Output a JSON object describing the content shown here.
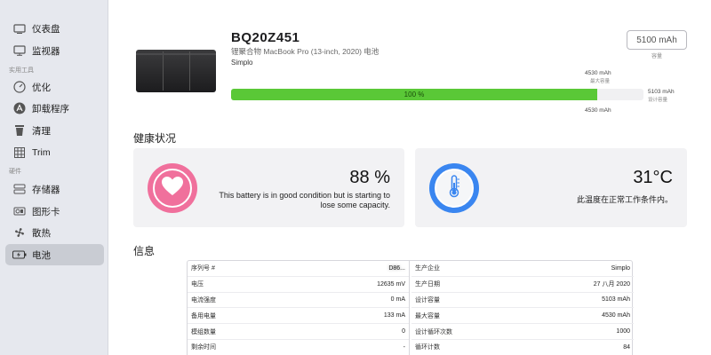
{
  "sidebar": {
    "items": [
      {
        "label": "仪表盘",
        "icon": "monitor-icon"
      },
      {
        "label": "监视器",
        "icon": "display-icon"
      },
      {
        "label": "优化",
        "icon": "gauge-icon"
      },
      {
        "label": "卸载程序",
        "icon": "app-store-icon"
      },
      {
        "label": "清理",
        "icon": "trash-icon"
      },
      {
        "label": "Trim",
        "icon": "grid-icon"
      },
      {
        "label": "存储器",
        "icon": "drive-icon"
      },
      {
        "label": "图形卡",
        "icon": "gpu-icon"
      },
      {
        "label": "散热",
        "icon": "fan-icon"
      },
      {
        "label": "电池",
        "icon": "battery-icon"
      }
    ],
    "sections": {
      "tools": "实用工具",
      "hardware": "硬件"
    },
    "active": "电池"
  },
  "header": {
    "title": "BQ20Z451",
    "subtitle": "锂聚合物 MacBook Pro (13-inch, 2020) 电池",
    "maker": "Simplo",
    "design_capacity_box": "5100 mAh",
    "design_capacity_label": "容量"
  },
  "capacity_bar": {
    "top_marker_value": "4530 mAh",
    "top_marker_label": "最大容量",
    "right_marker_value": "5103 mAh",
    "right_marker_label": "设计容量",
    "bottom_marker_value": "4530 mAh",
    "fill_text": "100 %",
    "fill_fraction": 0.888,
    "accent": "#5ac837"
  },
  "health": {
    "heading": "健康状况",
    "percent": "88 %",
    "description_line1": "This battery is in good condition but is starting to",
    "description_line2": "lose some capacity.",
    "color": "#f0709c",
    "icon": "heart-icon"
  },
  "temperature": {
    "value": "31°C",
    "description": "此温度在正常工作条件内。",
    "color": "#3a86f0",
    "icon": "thermometer-icon"
  },
  "info": {
    "heading": "信息",
    "left_rows": [
      {
        "label": "序列号 #",
        "value": "D86..."
      },
      {
        "label": "电压",
        "value": "12635 mV"
      },
      {
        "label": "电流强度",
        "value": "0 mA"
      },
      {
        "label": "备用电量",
        "value": "133 mA"
      },
      {
        "label": "模组数量",
        "value": "0"
      },
      {
        "label": "剩余时间",
        "value": "-"
      }
    ],
    "right_rows": [
      {
        "label": "生产企业",
        "value": "Simplo"
      },
      {
        "label": "生产日期",
        "value": "27 八月 2020"
      },
      {
        "label": "设计容量",
        "value": "5103 mAh"
      },
      {
        "label": "最大容量",
        "value": "4530 mAh"
      },
      {
        "label": "设计循环次数",
        "value": "1000"
      },
      {
        "label": "循环计数",
        "value": "84"
      }
    ]
  }
}
